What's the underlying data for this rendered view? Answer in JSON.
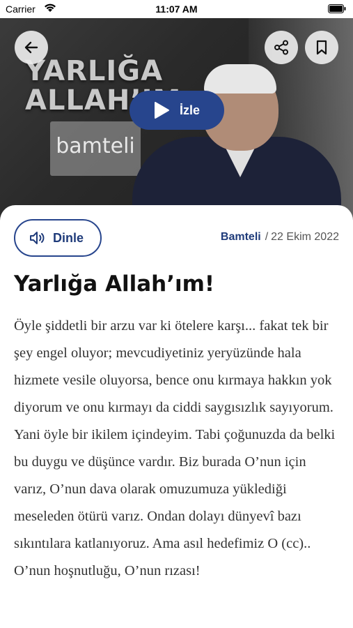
{
  "status_bar": {
    "carrier": "Carrier",
    "time": "11:07 AM"
  },
  "hero": {
    "overlay_title_lines": [
      "YARLIĞA",
      "ALLAH’IM"
    ],
    "logo_text": "bamteli",
    "watch_label": "İzle"
  },
  "actions": {
    "listen_label": "Dinle"
  },
  "meta": {
    "category": "Bamteli",
    "date": "22 Ekim 2022"
  },
  "article": {
    "title": "Yarlığa Allah’ım!",
    "body": "Öyle şiddetli bir arzu var ki ötelere karşı... fakat tek bir şey engel oluyor; mevcudiyetiniz yeryüzünde hala hizmete vesile oluyorsa, bence onu kırmaya hakkın yok diyorum ve onu kırmayı da ciddi saygısızlık sayıyorum. Yani öyle bir ikilem içindeyim. Tabi çoğunuzda da belki bu duygu ve düşünce vardır. Biz burada O’nun için varız, O’nun dava olarak omuzumuza yüklediği meseleden ötürü varız. Ondan dolayı dünyevî bazı sıkıntılara katlanıyoruz. Ama asıl hedefimiz O (cc).. O’nun hoşnutluğu, O’nun rızası!"
  },
  "colors": {
    "accent": "#27458d",
    "accent_text": "#1f3b7a"
  }
}
